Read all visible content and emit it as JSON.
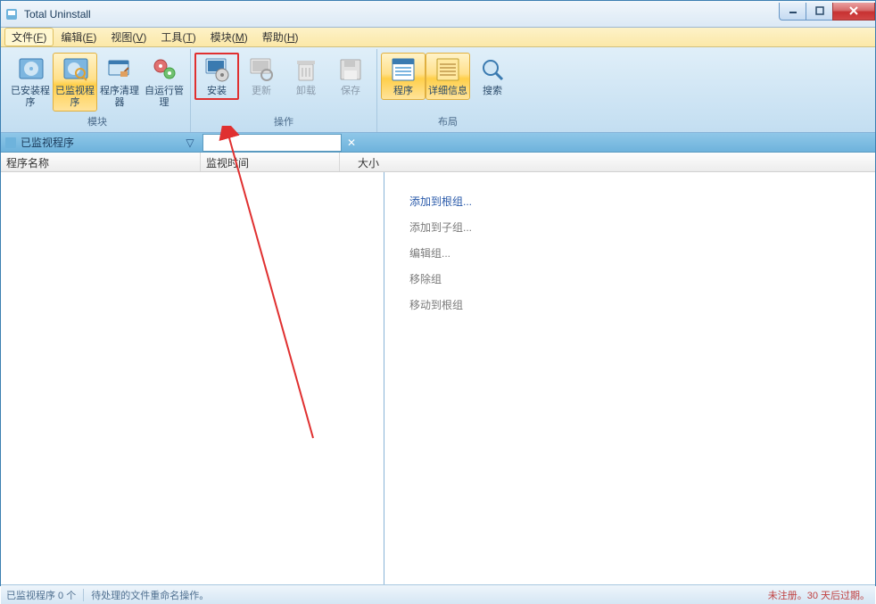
{
  "window": {
    "title": "Total Uninstall"
  },
  "menu": {
    "file": "文件",
    "file_hk": "F",
    "edit": "编辑",
    "edit_hk": "E",
    "view": "视图",
    "view_hk": "V",
    "tools": "工具",
    "tools_hk": "T",
    "modules": "模块",
    "modules_hk": "M",
    "help": "帮助",
    "help_hk": "H"
  },
  "ribbon": {
    "group_modules": "模块",
    "group_actions": "操作",
    "group_layout": "布局",
    "installed": "已安装程序",
    "monitored": "已监视程序",
    "cleaner": "程序清理器",
    "autorun": "自运行管理",
    "install": "安装",
    "update": "更新",
    "uninstall": "卸载",
    "save": "保存",
    "programs": "程序",
    "details": "详细信息",
    "search": "搜索"
  },
  "panel": {
    "left_title": "已监视程序",
    "col_name": "程序名称",
    "col_date": "监视时间",
    "col_size": "大小"
  },
  "context": {
    "add_root": "添加到根组...",
    "add_sub": "添加到子组...",
    "edit_group": "编辑组...",
    "remove_group": "移除组",
    "move_root": "移动到根组"
  },
  "status": {
    "count": "已监视程序 0 个",
    "pending": "待处理的文件重命名操作。",
    "trial": "未注册。30 天后过期。"
  }
}
